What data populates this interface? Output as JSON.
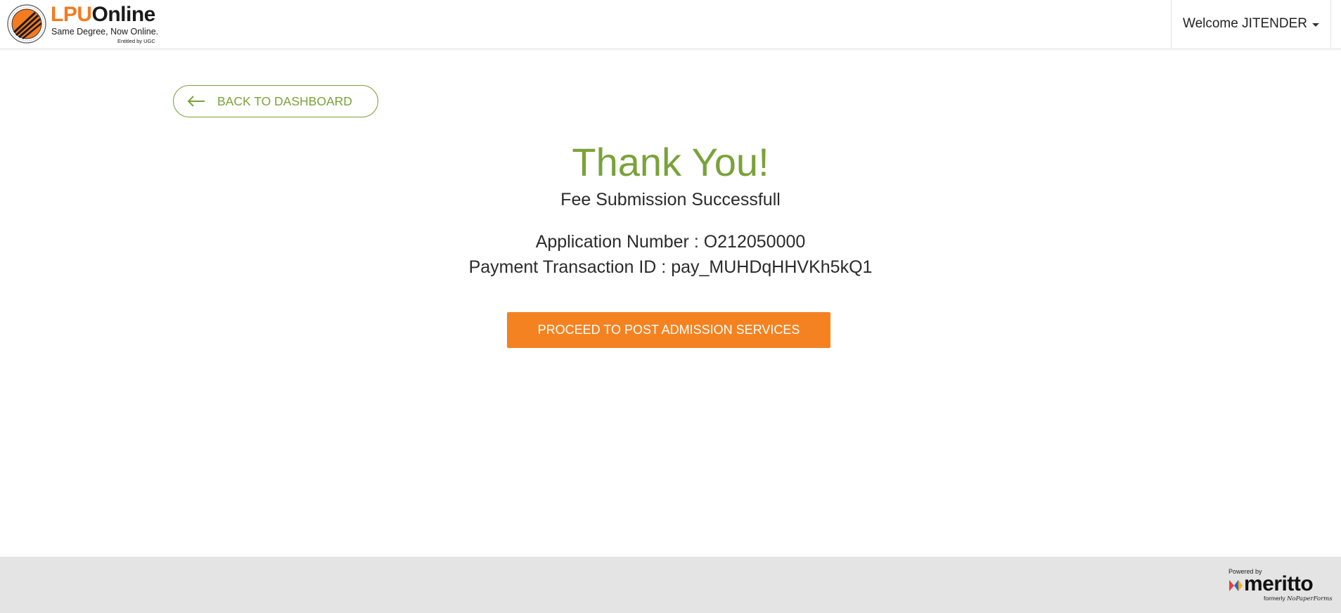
{
  "header": {
    "logo": {
      "brand_part1": "LPU",
      "brand_part2": "Online",
      "tagline": "Same Degree, Now Online.",
      "subline": "Entitled by UGC",
      "brand_color": "#f47b20"
    },
    "welcome_label": "Welcome JITENDER",
    "welcome_icon": "caret-down-icon"
  },
  "back_button": {
    "label": "BACK TO DASHBOARD",
    "icon": "arrow-left-icon"
  },
  "confirmation": {
    "title": "Thank You!",
    "message": "Fee Submission Successfull",
    "application_number": "Application Number : O212050000",
    "transaction_id": "Payment Transaction ID : pay_MUHDqHHVKh5kQ1"
  },
  "proceed_button": {
    "label": "PROCEED TO POST ADMISSION SERVICES"
  },
  "footer": {
    "powered_by": "Powered by",
    "brand": "meritto",
    "formerly_prefix": "formerly",
    "formerly_name": "NoPaperForms"
  },
  "colors": {
    "accent_green": "#7aa23a",
    "button_orange": "#f58220",
    "footer_bg": "#e4e4e4"
  }
}
